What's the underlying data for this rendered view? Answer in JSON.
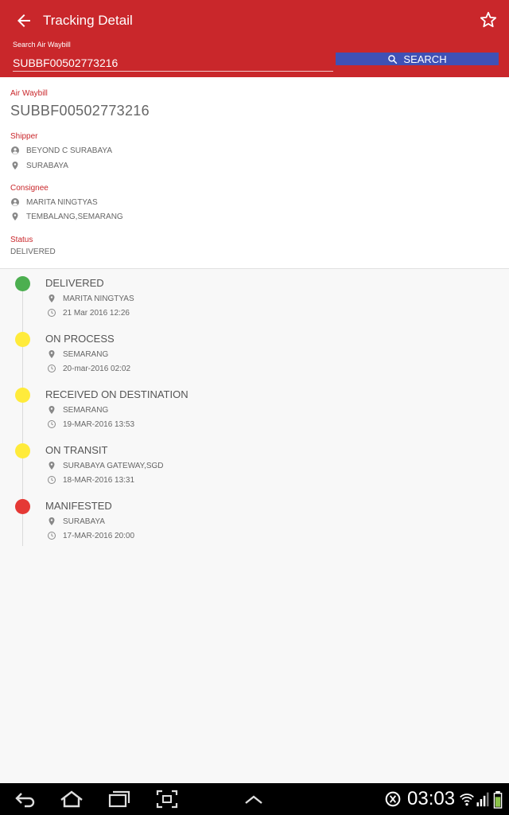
{
  "appbar": {
    "title": "Tracking Detail",
    "search_label": "Search Air Waybill",
    "search_value": "SUBBF00502773216",
    "search_button": "SEARCH"
  },
  "details": {
    "awb_label": "Air Waybill",
    "awb_value": "SUBBF00502773216",
    "shipper_label": "Shipper",
    "shipper_name": "BEYOND C SURABAYA",
    "shipper_city": "SURABAYA",
    "consignee_label": "Consignee",
    "consignee_name": "MARITA NINGTYAS",
    "consignee_city": "TEMBALANG,SEMARANG",
    "status_label": "Status",
    "status_value": "DELIVERED"
  },
  "timeline": [
    {
      "status": "DELIVERED",
      "location": "MARITA NINGTYAS",
      "time": "21 Mar 2016  12:26",
      "color": "#4caf50"
    },
    {
      "status": "ON PROCESS",
      "location": "SEMARANG",
      "time": "20-mar-2016 02:02",
      "color": "#ffeb3b"
    },
    {
      "status": "RECEIVED ON DESTINATION",
      "location": "SEMARANG",
      "time": "19-MAR-2016 13:53",
      "color": "#ffeb3b"
    },
    {
      "status": "ON TRANSIT",
      "location": "SURABAYA GATEWAY,SGD",
      "time": "18-MAR-2016 13:31",
      "color": "#ffeb3b"
    },
    {
      "status": "MANIFESTED",
      "location": "SURABAYA",
      "time": "17-MAR-2016 20:00",
      "color": "#e53935"
    }
  ],
  "statusbar": {
    "time": "03:03"
  },
  "colors": {
    "primary": "#c9272b",
    "button": "#3f51b5"
  }
}
